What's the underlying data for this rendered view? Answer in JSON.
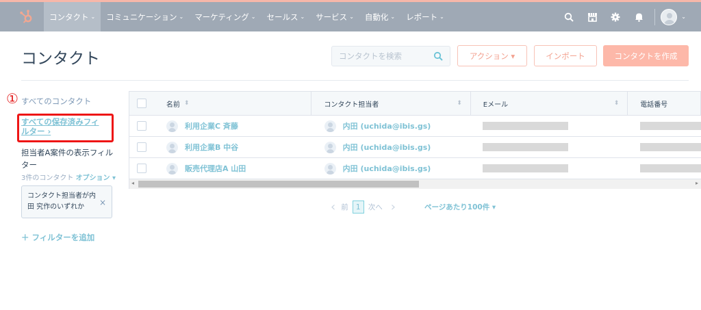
{
  "nav": {
    "items": [
      {
        "label": "コンタクト",
        "active": true
      },
      {
        "label": "コミュニケーション",
        "active": false
      },
      {
        "label": "マーケティング",
        "active": false
      },
      {
        "label": "セールス",
        "active": false
      },
      {
        "label": "サービス",
        "active": false
      },
      {
        "label": "自動化",
        "active": false
      },
      {
        "label": "レポート",
        "active": false
      }
    ],
    "caret": "⌄",
    "icons": [
      "search-icon",
      "marketplace-icon",
      "settings-icon",
      "notifications-icon"
    ],
    "colors": {
      "bar": "#9fa9b5",
      "active": "#b5bec8",
      "accent_top": "#f7b7a9"
    }
  },
  "page": {
    "title": "コンタクト",
    "search_placeholder": "コンタクトを検索",
    "action_label": "アクション ▾",
    "import_label": "インポート",
    "create_label": "コンタクトを作成"
  },
  "sidebar": {
    "annotation_number": "①",
    "all_contacts": "すべてのコンタクト",
    "saved_filters_link": "すべての保存済みフィルター ›",
    "filter_name": "担当者A案件の表示フィルター",
    "filter_count": "3件のコンタクト",
    "filter_options": "オプション ▾",
    "chip_text": "コンタクト担当者が内田 究作のいずれか",
    "chip_close": "×",
    "add_filter": "＋ フィルターを追加",
    "highlight_color": "#ee1515"
  },
  "table": {
    "headers": {
      "name": "名前",
      "owner": "コンタクト担当者",
      "email": "Eメール",
      "phone": "電話番号"
    },
    "sort_glyph": "⬍",
    "rows": [
      {
        "name": "利用企業C 斉藤",
        "owner": "内田 (uchida@ibis.gs)"
      },
      {
        "name": "利用企業B 中谷",
        "owner": "内田 (uchida@ibis.gs)"
      },
      {
        "name": "販売代理店A 山田",
        "owner": "内田 (uchida@ibis.gs)"
      }
    ]
  },
  "pager": {
    "prev": "前",
    "current": "1",
    "next": "次へ",
    "per_page": "ページあたり100件 ▾"
  }
}
